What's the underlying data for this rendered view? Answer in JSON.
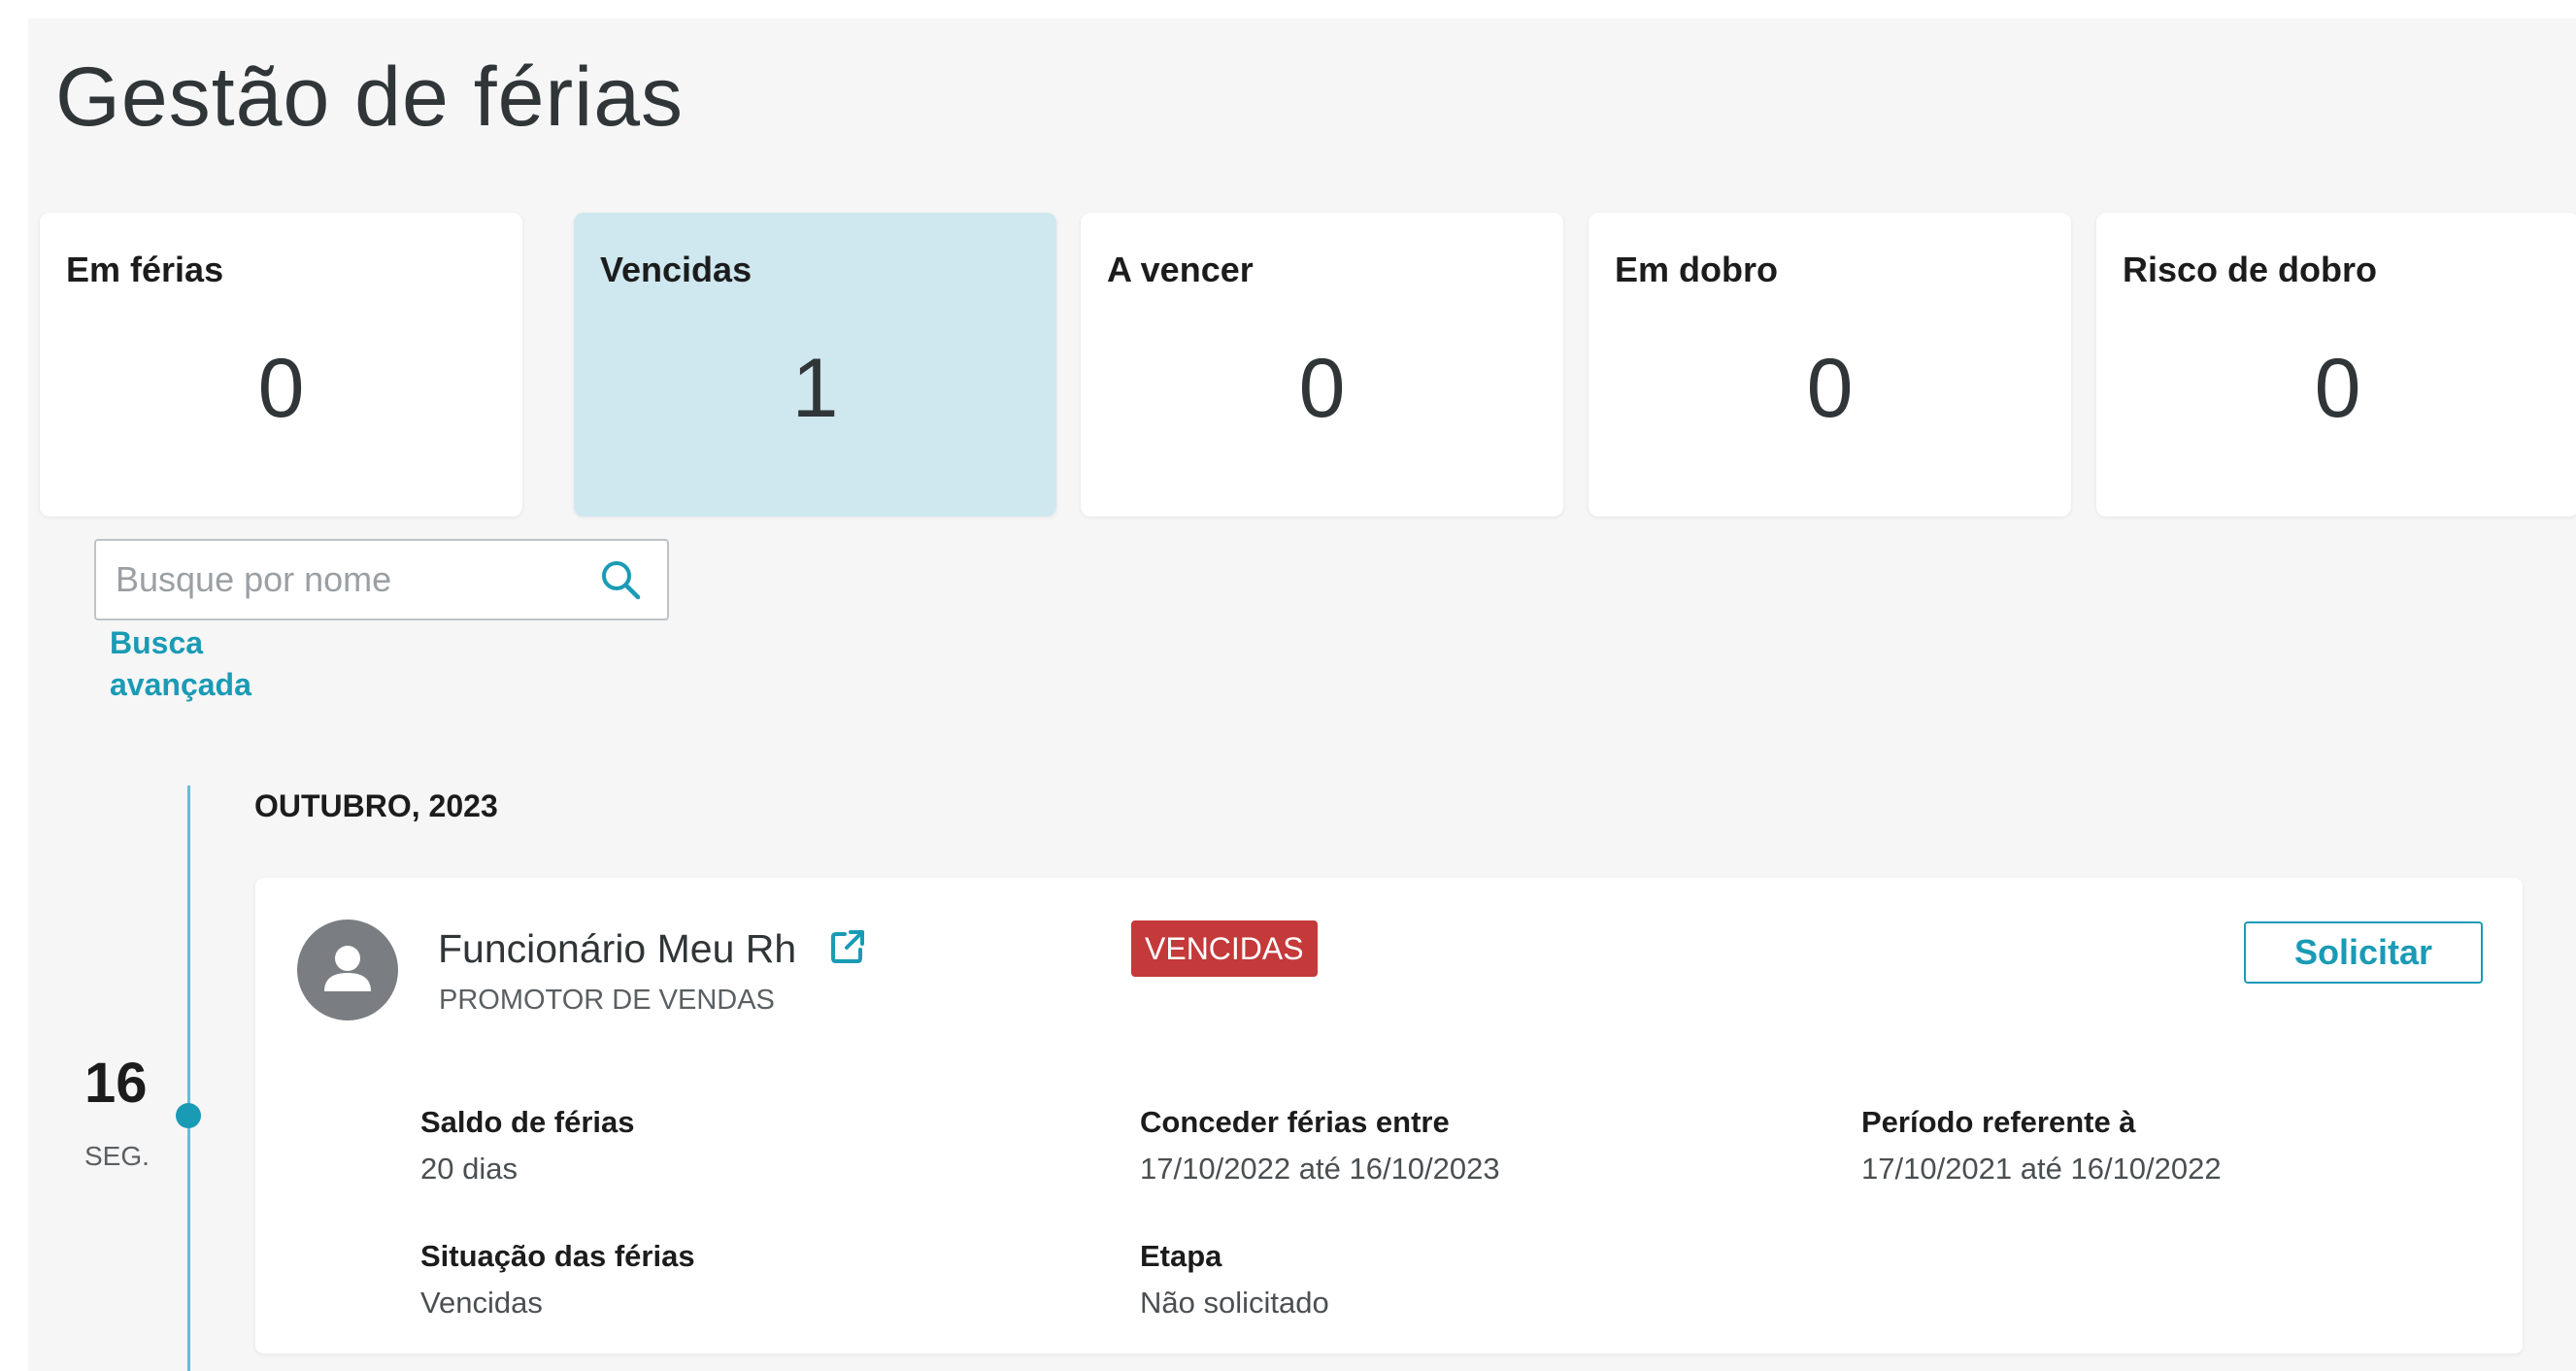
{
  "page": {
    "title": "Gestão de férias"
  },
  "summary_cards": [
    {
      "label": "Em férias",
      "value": "0"
    },
    {
      "label": "Vencidas",
      "value": "1"
    },
    {
      "label": "A vencer",
      "value": "0"
    },
    {
      "label": "Em dobro",
      "value": "0"
    },
    {
      "label": "Risco de dobro",
      "value": "0"
    }
  ],
  "search": {
    "placeholder": "Busque por nome",
    "value": "",
    "icon": "search-icon",
    "advanced_label": "Busca avançada"
  },
  "timeline": {
    "month": "OUTUBRO, 2023",
    "day_number": "16",
    "day_week": "SEG."
  },
  "employee": {
    "name": "Funcionário Meu Rh",
    "role": "PROMOTOR DE VENDAS",
    "status_badge": "VENCIDAS",
    "request_button": "Solicitar",
    "fields": {
      "balance": {
        "label": "Saldo de férias",
        "value": "20 dias"
      },
      "grant_between": {
        "label": "Conceder férias entre",
        "value": "17/10/2022 até 16/10/2023"
      },
      "reference_period": {
        "label": "Período referente à",
        "value": "17/10/2021 até 16/10/2022"
      },
      "situation": {
        "label": "Situação das férias",
        "value": "Vencidas"
      },
      "stage": {
        "label": "Etapa",
        "value": "Não solicitado"
      }
    }
  },
  "colors": {
    "accent": "#1a9bb5",
    "active_card": "#cfe8f0",
    "badge_red": "#c4393a",
    "page_bg": "#f6f6f7"
  }
}
